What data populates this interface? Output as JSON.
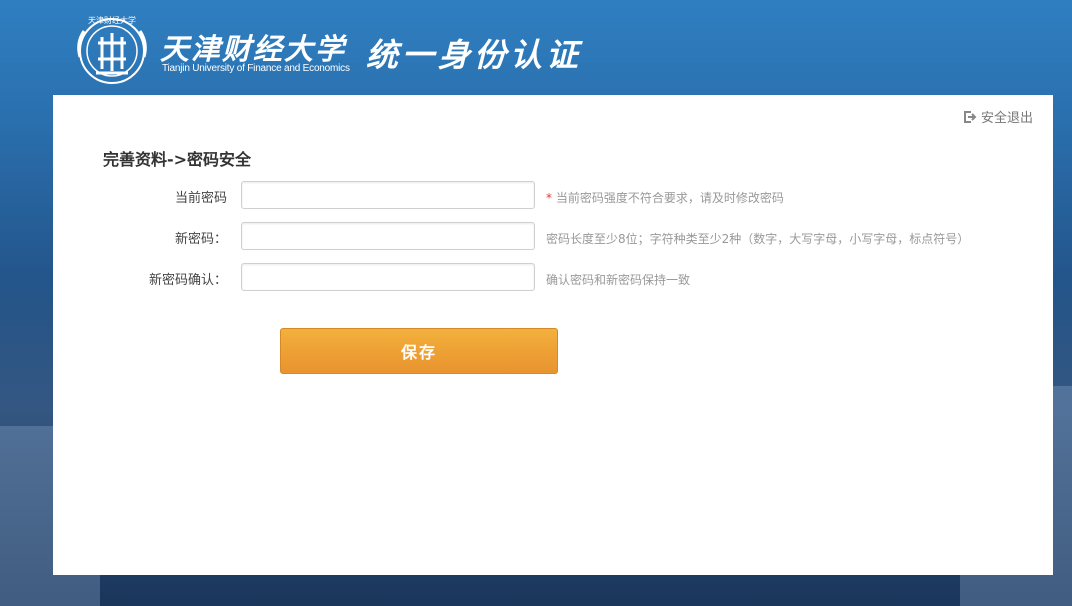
{
  "header": {
    "university_name": "天津财经大学",
    "university_name_en": "Tianjin University of Finance and Economics",
    "system_title": "统一身份认证"
  },
  "panel": {
    "logout_label": "安全退出",
    "section_title": "完善资料->密码安全",
    "fields": [
      {
        "label": "当前密码",
        "value": "",
        "hint_star": "*",
        "hint": "当前密码强度不符合要求，请及时修改密码"
      },
      {
        "label": "新密码：",
        "value": "",
        "hint": "密码长度至少8位；字符种类至少2种（数字，大写字母，小写字母，标点符号）"
      },
      {
        "label": "新密码确认：",
        "value": "",
        "hint": "确认密码和新密码保持一致"
      }
    ],
    "save_label": "保存"
  },
  "colors": {
    "header_blue": "#2f7fc0",
    "button_orange": "#eea135",
    "hint_star_red": "#e03a2e"
  },
  "icons": {
    "logo": "university-emblem-icon",
    "logout": "logout-icon"
  }
}
